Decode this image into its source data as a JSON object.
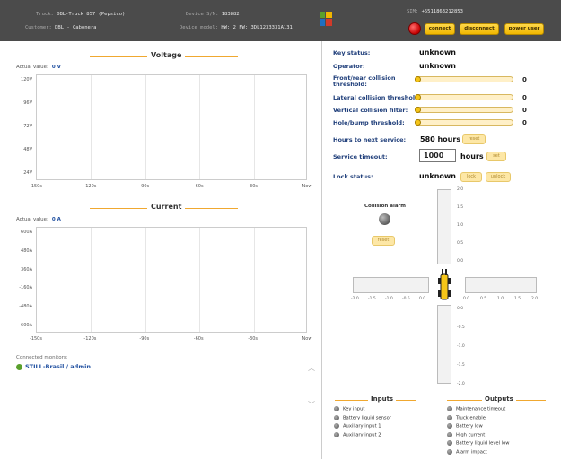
{
  "header": {
    "truck_label": "Truck:",
    "truck_value": "DBL-Truck 857 (Pepsico)",
    "customer_label": "Customer:",
    "customer_value": "DBL - Cabonera",
    "serial_label": "Device S/N:",
    "serial_value": "183882",
    "model_label": "Device model:",
    "model_value": "HW: 2 FW: 3DL1233331A131",
    "sim_label": "SIM:",
    "sim_value": "+5511863212853",
    "connect_label": "connect",
    "disconnect_label": "disconnect",
    "power_user_label": "power user",
    "colors": {
      "status": "#c40000",
      "button": "#f5c518"
    }
  },
  "voltage": {
    "title": "Voltage",
    "actual_label": "Actual value:",
    "actual_value": "0 V",
    "y_ticks": [
      "120V",
      "96V",
      "72V",
      "48V",
      "24V"
    ],
    "x_ticks": [
      "-150s",
      "-120s",
      "-90s",
      "-60s",
      "-30s",
      "Now"
    ]
  },
  "current": {
    "title": "Current",
    "actual_label": "Actual value:",
    "actual_value": "0 A",
    "y_ticks": [
      "600A",
      "480A",
      "360A",
      "-160A",
      "-480A",
      "-600A"
    ],
    "x_ticks": [
      "-150s",
      "-120s",
      "-90s",
      "-60s",
      "-30s",
      "Now"
    ]
  },
  "monitors": {
    "label": "Connected monitors:",
    "items": [
      "STILL-Brasil / admin"
    ]
  },
  "status": {
    "key_status_label": "Key status:",
    "key_status_value": "unknown",
    "operator_label": "Operator:",
    "operator_value": "unknown",
    "front_rear_label": "Front/rear collision threshold:",
    "front_rear_value": "0",
    "lateral_label": "Lateral collision threshold:",
    "lateral_value": "0",
    "vertical_label": "Vertical collision filter:",
    "vertical_value": "0",
    "hole_label": "Hole/bump threshold:",
    "hole_value": "0",
    "hours_label": "Hours to next service:",
    "hours_value": "580 hours",
    "reset_label": "reset",
    "timeout_label": "Service timeout:",
    "timeout_value": "1000",
    "timeout_unit": "hours",
    "set_label": "set",
    "lock_label": "Lock status:",
    "lock_value": "unknown",
    "lock_button": "lock",
    "unlock_button": "unlock"
  },
  "collision": {
    "title": "Collision alarm",
    "reset_label": "reset",
    "v_top_ticks": [
      "2.0",
      "1.5",
      "1.0",
      "0.5",
      "0.0"
    ],
    "v_bottom_ticks": [
      "0.0",
      "-0.5",
      "-1.0",
      "-1.5",
      "-2.0"
    ],
    "h_left_ticks": [
      "-2.0",
      "-1.5",
      "-1.0",
      "-0.5",
      "0.0"
    ],
    "h_right_ticks": [
      "0.0",
      "0.5",
      "1.0",
      "1.5",
      "2.0"
    ]
  },
  "inputs": {
    "title": "Inputs",
    "items": [
      "Key input",
      "Battery liquid sensor",
      "Auxiliary input 1",
      "Auxiliary input 2"
    ]
  },
  "outputs": {
    "title": "Outputs",
    "items": [
      "Maintenance timeout",
      "Truck enable",
      "Battery low",
      "High current",
      "Battery liquid level low",
      "Alarm impact"
    ]
  }
}
